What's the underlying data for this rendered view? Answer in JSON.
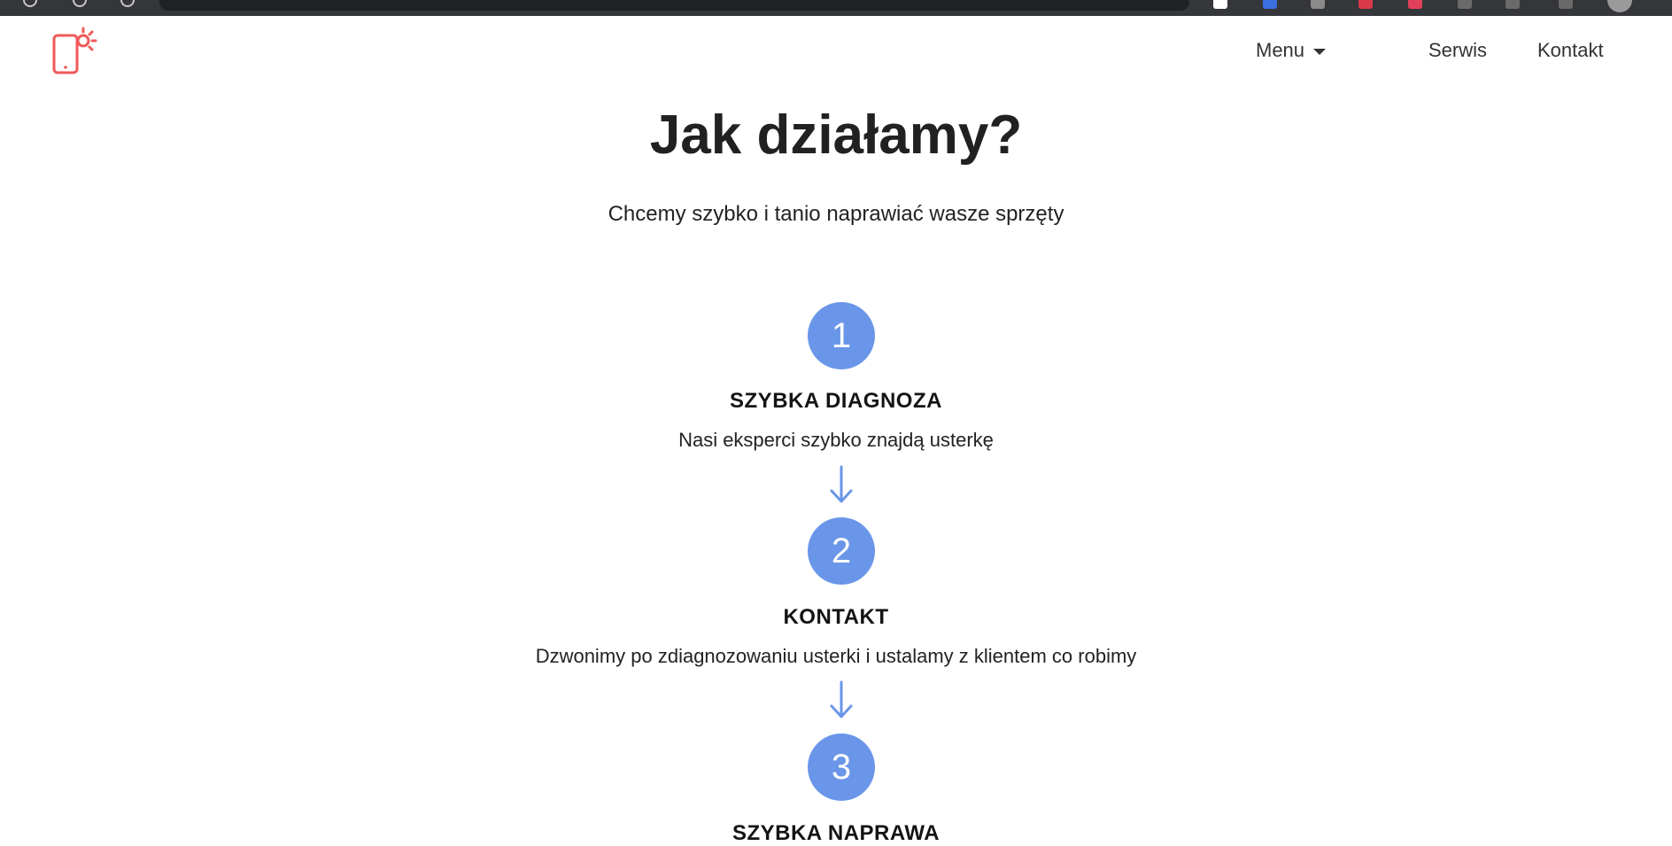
{
  "header": {
    "nav": {
      "menu_label": "Menu",
      "service_label": "Serwis",
      "contact_label": "Kontakt"
    }
  },
  "main": {
    "title": "Jak działamy?",
    "subtitle": "Chcemy szybko i tanio naprawiać wasze sprzęty",
    "steps": [
      {
        "number": "1",
        "title": "SZYBKA DIAGNOZA",
        "description": "Nasi eksperci szybko znajdą usterkę"
      },
      {
        "number": "2",
        "title": "KONTAKT",
        "description": "Dzwonimy po zdiagnozowaniu usterki i ustalamy z klientem co robimy"
      },
      {
        "number": "3",
        "title": "SZYBKA NAPRAWA",
        "description": ""
      }
    ]
  },
  "colors": {
    "accent": "#6a96e9",
    "logo": "#f05a5a",
    "text": "#212121"
  },
  "icons": {
    "logo": "phone-repair-logo-icon",
    "menu_caret": "caret-down-icon",
    "step_arrow": "arrow-down-icon"
  }
}
